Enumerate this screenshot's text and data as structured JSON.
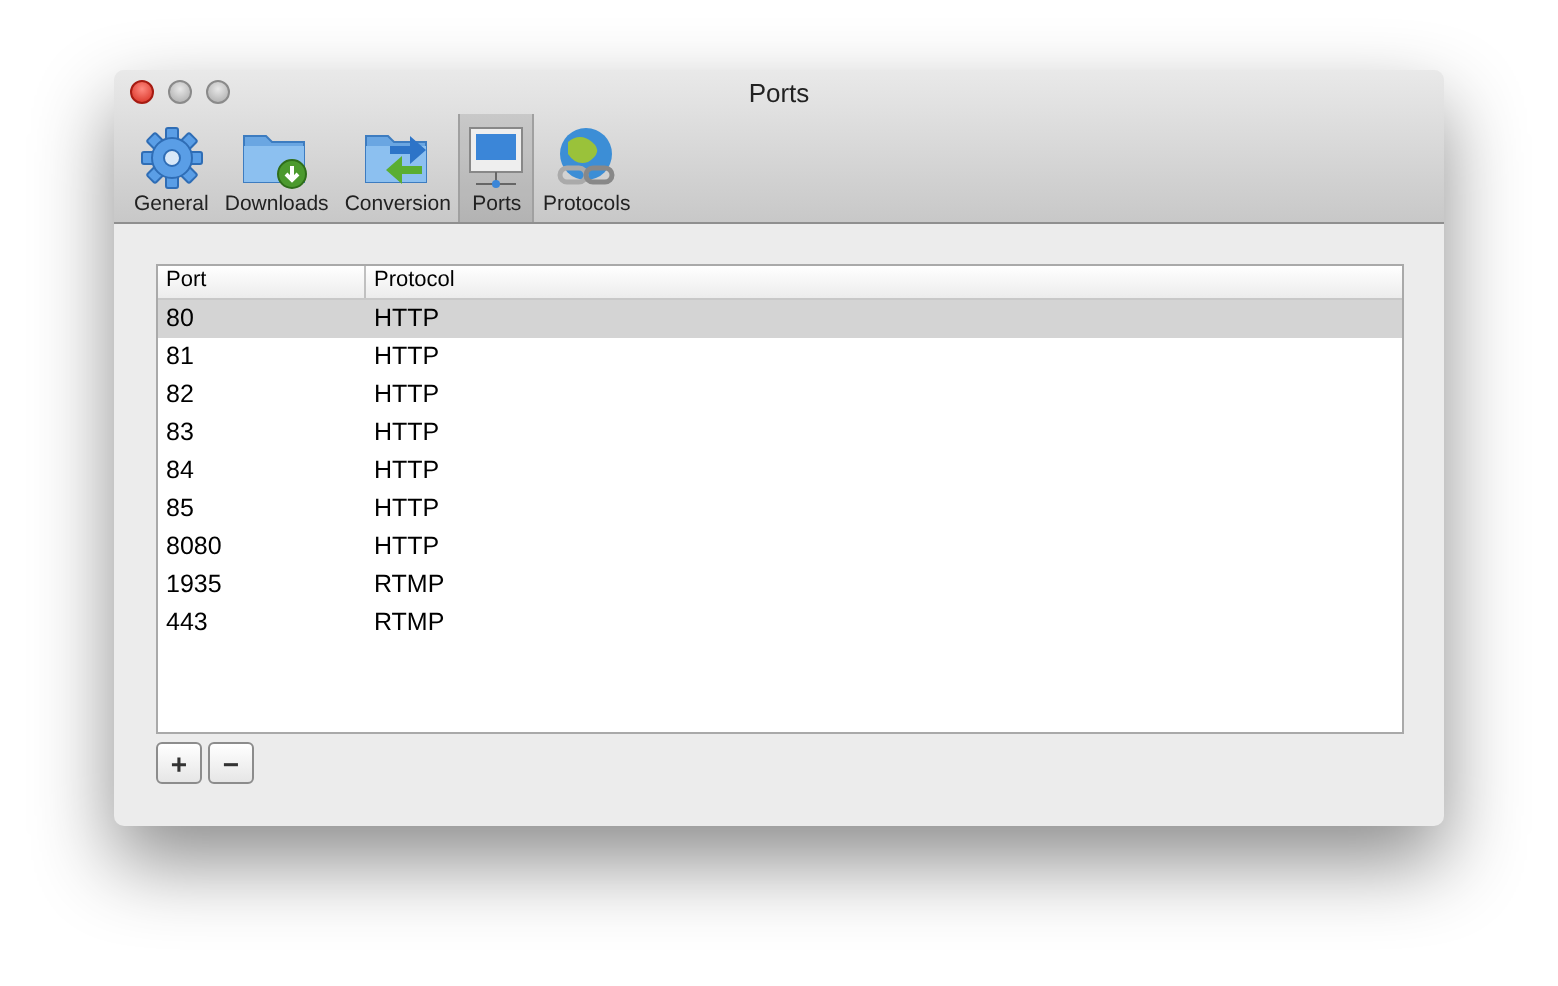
{
  "window": {
    "title": "Ports"
  },
  "toolbar": [
    {
      "label": "General",
      "kind": "gear",
      "selected": false
    },
    {
      "label": "Downloads",
      "kind": "download-folder",
      "selected": false
    },
    {
      "label": "Conversion",
      "kind": "convert-folder",
      "selected": false
    },
    {
      "label": "Ports",
      "kind": "monitor",
      "selected": true
    },
    {
      "label": "Protocols",
      "kind": "globe",
      "selected": false
    }
  ],
  "table": {
    "columns": [
      "Port",
      "Protocol"
    ],
    "rows": [
      {
        "port": "80",
        "protocol": "HTTP",
        "selected": true
      },
      {
        "port": "81",
        "protocol": "HTTP",
        "selected": false
      },
      {
        "port": "82",
        "protocol": "HTTP",
        "selected": false
      },
      {
        "port": "83",
        "protocol": "HTTP",
        "selected": false
      },
      {
        "port": "84",
        "protocol": "HTTP",
        "selected": false
      },
      {
        "port": "85",
        "protocol": "HTTP",
        "selected": false
      },
      {
        "port": "8080",
        "protocol": "HTTP",
        "selected": false
      },
      {
        "port": "1935",
        "protocol": "RTMP",
        "selected": false
      },
      {
        "port": "443",
        "protocol": "RTMP",
        "selected": false
      }
    ]
  },
  "buttons": [
    "+",
    "−"
  ]
}
